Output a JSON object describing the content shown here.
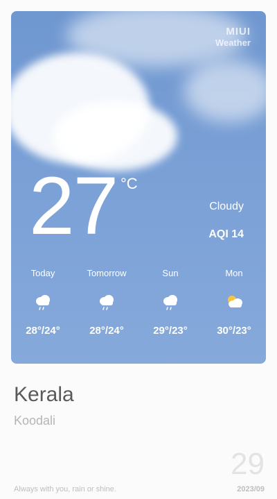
{
  "brand": {
    "line1": "MIUI",
    "line2": "Weather"
  },
  "current": {
    "temperature": "27",
    "unit": "°C",
    "condition": "Cloudy",
    "aqi": "AQI 14"
  },
  "forecast": [
    {
      "day": "Today",
      "icon": "rain-cloud-icon",
      "range": "28°/24°"
    },
    {
      "day": "Tomorrow",
      "icon": "rain-cloud-icon",
      "range": "28°/24°"
    },
    {
      "day": "Sun",
      "icon": "rain-cloud-icon",
      "range": "29°/23°"
    },
    {
      "day": "Mon",
      "icon": "partly-cloudy-icon",
      "range": "30°/23°"
    }
  ],
  "location": {
    "city": "Kerala",
    "area": "Koodali"
  },
  "footer": {
    "tagline": "Always with you, rain or shine.",
    "date_day": "29",
    "date_year_month": "2023/09"
  },
  "colors": {
    "sky_top": "#6f97d0",
    "sky_bottom": "#86a9db",
    "city_text": "#5a5a5a",
    "muted_text": "#b5b5b5"
  }
}
